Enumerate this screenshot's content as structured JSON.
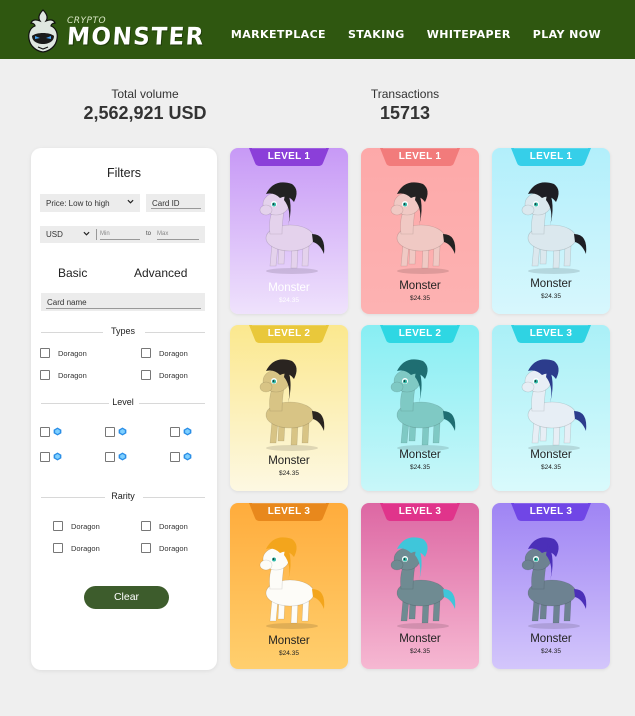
{
  "header": {
    "logo_small": "CRYPTO",
    "logo_big": "MONSTER",
    "nav": [
      "MARKETPLACE",
      "STAKING",
      "WHITEPAPER",
      "PLAY NOW"
    ]
  },
  "stats": {
    "volume_label": "Total volume",
    "volume_value": "2,562,921 USD",
    "tx_label": "Transactions",
    "tx_value": "15713"
  },
  "filters": {
    "title": "Filters",
    "sort_value": "Price: Low to high",
    "card_id_placeholder": "Card ID",
    "currency_value": "USD",
    "min_placeholder": "Min",
    "to_label": "to",
    "max_placeholder": "Max",
    "tab_basic": "Basic",
    "tab_advanced": "Advanced",
    "card_name_placeholder": "Card name",
    "types_heading": "Types",
    "types": [
      "Doragon",
      "Doragon",
      "Doragon",
      "Doragon"
    ],
    "level_heading": "Level",
    "rarity_heading": "Rarity",
    "rarity": [
      "Doragon",
      "Doragon",
      "Doragon",
      "Doragon"
    ],
    "clear_label": "Clear"
  },
  "cards": [
    {
      "level": "LEVEL 1",
      "name": "Monster",
      "price": "$24.35",
      "bg_top": "#c799f6",
      "bg_bottom": "#efe2fc",
      "badge": "#8b3fd9",
      "text_color": "#ffffff",
      "body": "#e4d2ec",
      "hair": "#222222"
    },
    {
      "level": "LEVEL 1",
      "name": "Monster",
      "price": "$24.35",
      "bg_top": "#fda9a9",
      "bg_bottom": "#fdb2b2",
      "badge": "#f27b7b",
      "text_color": "#222222",
      "body": "#f0c9c4",
      "hair": "#222222"
    },
    {
      "level": "LEVEL 1",
      "name": "Monster",
      "price": "$24.35",
      "bg_top": "#b2effb",
      "bg_bottom": "#d7f7fd",
      "badge": "#36cfe9",
      "text_color": "#222222",
      "body": "#dbe8ee",
      "hair": "#1e1e24"
    },
    {
      "level": "LEVEL 2",
      "name": "Monster",
      "price": "$24.35",
      "bg_top": "#fbe88e",
      "bg_bottom": "#fdf8e2",
      "badge": "#e9c83b",
      "text_color": "#222222",
      "body": "#d8c485",
      "hair": "#2a2420"
    },
    {
      "level": "LEVEL 2",
      "name": "Monster",
      "price": "$24.35",
      "bg_top": "#88eef3",
      "bg_bottom": "#c8f7f9",
      "badge": "#2ed7e3",
      "text_color": "#222222",
      "body": "#7fc9c4",
      "hair": "#1f6e72"
    },
    {
      "level": "LEVEL 3",
      "name": "Monster",
      "price": "$24.35",
      "bg_top": "#aaf0f7",
      "bg_bottom": "#d9fafc",
      "badge": "#2fd3e3",
      "text_color": "#222222",
      "body": "#e7eef5",
      "hair": "#2c3c8c"
    },
    {
      "level": "LEVEL 3",
      "name": "Monster",
      "price": "$24.35",
      "bg_top": "#ffac3c",
      "bg_bottom": "#ffcf6e",
      "badge": "#e8881c",
      "text_color": "#222222",
      "body": "#fdfcf8",
      "hair": "#f3a51c"
    },
    {
      "level": "LEVEL 3",
      "name": "Monster",
      "price": "$24.35",
      "bg_top": "#dd67a3",
      "bg_bottom": "#f6b8d2",
      "badge": "#e0348b",
      "text_color": "#222222",
      "body": "#6f8b92",
      "hair": "#3fc6da"
    },
    {
      "level": "LEVEL 3",
      "name": "Monster",
      "price": "$24.35",
      "bg_top": "#9f84f4",
      "bg_bottom": "#d3c6fb",
      "badge": "#7046e6",
      "text_color": "#222222",
      "body": "#6d8291",
      "hair": "#4b2fb8"
    }
  ]
}
